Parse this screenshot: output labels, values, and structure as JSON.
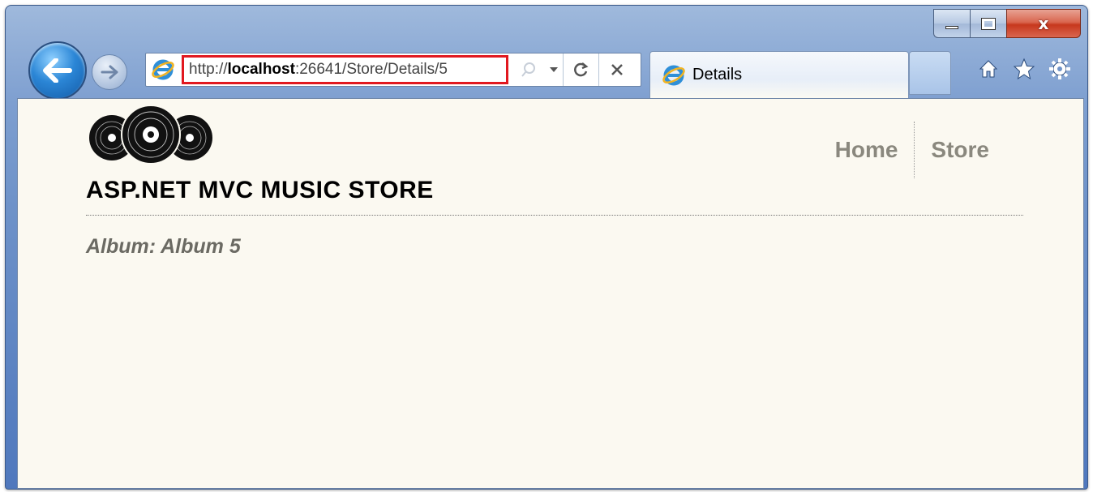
{
  "browser": {
    "address_bar": {
      "url_prefix": "http://",
      "url_host": "localhost",
      "url_suffix": ":26641/Store/Details/5"
    },
    "tab": {
      "title": "Details"
    },
    "caption": {
      "close_label": "x"
    },
    "icons": [
      "back-arrow-icon",
      "forward-arrow-icon",
      "ie-icon",
      "search-icon",
      "dropdown-icon",
      "refresh-icon",
      "stop-icon",
      "home-icon",
      "favorites-star-icon",
      "tools-gear-icon"
    ]
  },
  "site": {
    "title": "ASP.NET MVC MUSIC STORE",
    "nav": {
      "home": "Home",
      "store": "Store"
    }
  },
  "page": {
    "heading": "Album: Album 5"
  },
  "colors": {
    "highlight_border": "#e1181f",
    "content_background": "#fbf9f1",
    "nav_text": "#8a887e",
    "heading_text": "#6b6a63"
  }
}
